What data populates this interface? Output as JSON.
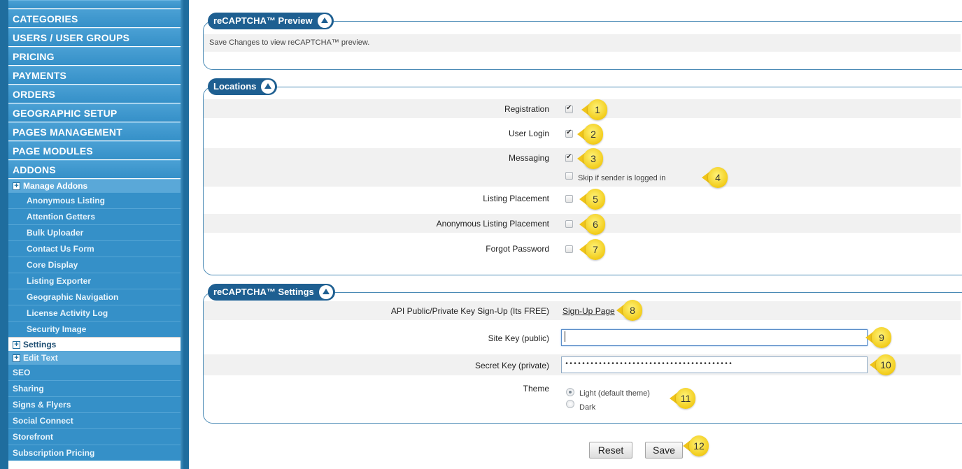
{
  "sidebar": {
    "menu": [
      "CATEGORIES",
      "USERS / USER GROUPS",
      "PRICING",
      "PAYMENTS",
      "ORDERS",
      "GEOGRAPHIC SETUP",
      "PAGES MANAGEMENT",
      "PAGE MODULES",
      "ADDONS"
    ],
    "manage_addons": "Manage Addons",
    "addons": [
      "Anonymous Listing",
      "Attention Getters",
      "Bulk Uploader",
      "Contact Us Form",
      "Core Display",
      "Listing Exporter",
      "Geographic Navigation",
      "License Activity Log",
      "Security Image"
    ],
    "settings": "Settings",
    "edit_text": "Edit Text",
    "addons_after": [
      "SEO",
      "Sharing",
      "Signs & Flyers",
      "Social Connect",
      "Storefront",
      "Subscription Pricing"
    ]
  },
  "preview": {
    "legend": "reCAPTCHA™ Preview",
    "message": "Save Changes to view reCAPTCHA™ preview."
  },
  "locations": {
    "legend": "Locations",
    "rows": [
      {
        "label": "Registration",
        "checked": true,
        "badge": "1"
      },
      {
        "label": "User Login",
        "checked": true,
        "badge": "2"
      },
      {
        "label": "Messaging",
        "checked": true,
        "badge": "3"
      },
      {
        "label": "Listing Placement",
        "checked": false,
        "badge": "5"
      },
      {
        "label": "Anonymous Listing Placement",
        "checked": false,
        "badge": "6"
      },
      {
        "label": "Forgot Password",
        "checked": false,
        "badge": "7"
      }
    ],
    "skip_label": "Skip if sender is logged in",
    "skip_badge": "4"
  },
  "settings": {
    "legend": "reCAPTCHA™ Settings",
    "api_label": "API Public/Private Key Sign-Up (Its FREE)",
    "api_link": "Sign-Up Page",
    "api_badge": "8",
    "site_key_label": "Site Key (public)",
    "site_key_value": "",
    "site_key_badge": "9",
    "secret_key_label": "Secret Key (private)",
    "secret_key_value": "••••••••••••••••••••••••••••••••••••••••",
    "secret_key_badge": "10",
    "theme_label": "Theme",
    "theme_options": [
      "Light (default theme)",
      "Dark"
    ],
    "theme_selected": "Light (default theme)",
    "theme_badge": "11"
  },
  "buttons": {
    "reset": "Reset",
    "save": "Save",
    "save_badge": "12"
  },
  "colors": {
    "sidebar_blue": "#3590c8",
    "legend_blue": "#1e5f91",
    "badge_yellow": "#f2cc1a"
  }
}
